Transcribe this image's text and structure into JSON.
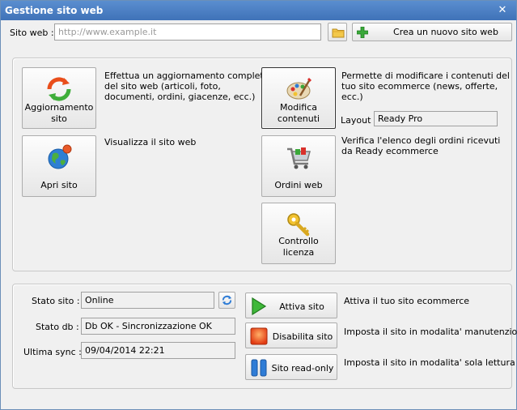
{
  "window": {
    "title": "Gestione sito web"
  },
  "top": {
    "site_label": "Sito web :",
    "site_value": "http://www.example.it",
    "new_site_label": "Crea un nuovo sito web"
  },
  "actions": {
    "update": {
      "label_line1": "Aggiornamento",
      "label_line2": "sito",
      "desc": "Effettua un aggiornamento completo\ndel sito web (articoli, foto,\ndocumenti, ordini, giacenze, ecc.)"
    },
    "open": {
      "label": "Apri sito",
      "desc": "Visualizza il sito web"
    },
    "edit": {
      "label_line1": "Modifica",
      "label_line2": "contenuti",
      "desc": "Permette di modificare i contenuti del\ntuo sito ecommerce (news, offerte,\necc.)"
    },
    "layout_label": "Layout :",
    "layout_value": "Ready Pro",
    "orders": {
      "label": "Ordini web",
      "desc": "Verifica l'elenco degli ordini ricevuti\nda Ready ecommerce"
    },
    "license": {
      "label": "Controllo licenza"
    }
  },
  "status": {
    "site_state_label": "Stato sito :",
    "site_state_value": "Online",
    "db_state_label": "Stato db :",
    "db_state_value": "Db OK - Sincronizzazione OK",
    "last_sync_label": "Ultima sync :",
    "last_sync_value": "09/04/2014 22:21",
    "activate_label": "Attiva sito",
    "activate_desc": "Attiva il tuo sito ecommerce",
    "disable_label": "Disabilita sito",
    "disable_desc": "Imposta il sito in modalita' manutenzione",
    "readonly_label": "Sito read-only",
    "readonly_desc": "Imposta il sito in modalita' sola lettura"
  }
}
